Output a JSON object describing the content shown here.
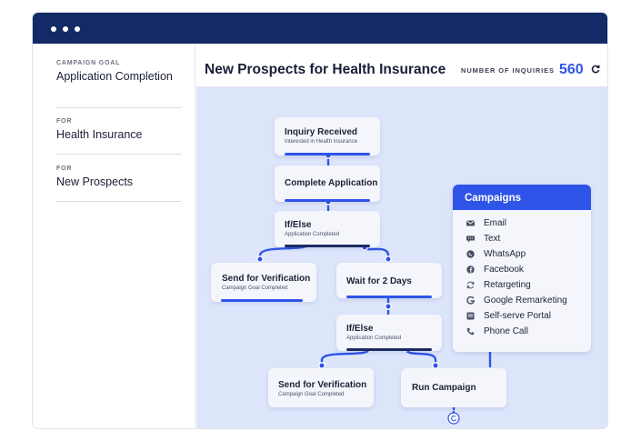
{
  "sidebar": {
    "items": [
      {
        "label": "CAMPAIGN GOAL",
        "value": "Application Completion"
      },
      {
        "label": "FOR",
        "value": "Health Insurance"
      },
      {
        "label": "FOR",
        "value": "New Prospects"
      }
    ]
  },
  "header": {
    "title": "New Prospects for Health Insurance",
    "inquiries_label": "NUMBER OF INQUIRIES",
    "inquiries_value": "560"
  },
  "flow": {
    "inquiry_received": {
      "title": "Inquiry Received",
      "subtitle": "Interested in Health Insurance"
    },
    "complete_application": {
      "title": "Complete Application"
    },
    "if_else_1": {
      "title": "If/Else",
      "subtitle": "Application Completed"
    },
    "send_verification_1": {
      "title": "Send for Verification",
      "subtitle": "Campaign Goal Completed"
    },
    "wait": {
      "title": "Wait for 2 Days"
    },
    "if_else_2": {
      "title": "If/Else",
      "subtitle": "Application Completed"
    },
    "send_verification_2": {
      "title": "Send for Verification",
      "subtitle": "Campaign Goal Completed"
    },
    "run_campaign": {
      "title": "Run Campaign"
    }
  },
  "campaigns": {
    "title": "Campaigns",
    "items": [
      {
        "label": "Email",
        "icon": "email-icon"
      },
      {
        "label": "Text",
        "icon": "text-message-icon"
      },
      {
        "label": "WhatsApp",
        "icon": "whatsapp-icon"
      },
      {
        "label": "Facebook",
        "icon": "facebook-icon"
      },
      {
        "label": "Retargeting",
        "icon": "retargeting-icon"
      },
      {
        "label": "Google Remarketing",
        "icon": "google-icon"
      },
      {
        "label": "Self-serve Portal",
        "icon": "portal-icon"
      },
      {
        "label": "Phone Call",
        "icon": "phone-icon"
      }
    ]
  },
  "colors": {
    "titlebar": "#142a66",
    "accent": "#2f54e8",
    "canvas": "#dde5fb",
    "node": "#f4f6fc"
  }
}
